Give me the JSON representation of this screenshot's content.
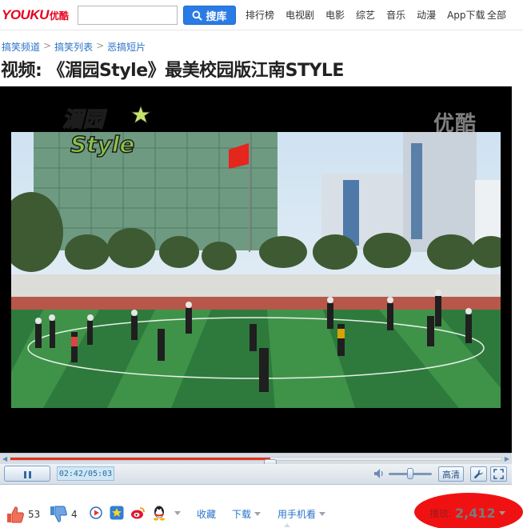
{
  "header": {
    "logo_text": "YOUKU",
    "logo_cn": "优酷",
    "search_placeholder": "",
    "search_button": "搜库",
    "nav": [
      "排行榜",
      "电视剧",
      "电影",
      "综艺",
      "音乐",
      "动漫",
      "App下载",
      "全部"
    ]
  },
  "breadcrumb": [
    "搞笑频道",
    "搞笑列表",
    "恶搞短片"
  ],
  "video": {
    "title": "视频: 《湄园Style》最美校园版江南STYLE",
    "watermark": "优酷",
    "show_logo_cn": "湄园",
    "show_logo_en": "Style",
    "progress_fraction": 0.53,
    "volume_fraction": 0.5
  },
  "controls": {
    "time": "02:42/05:03",
    "hd_label": "高清"
  },
  "actions": {
    "up_count": "53",
    "down_count": "4",
    "collect": "收藏",
    "download": "下载",
    "mobile": "用手机看",
    "plays_label": "播放:",
    "plays_count": "2,412"
  },
  "colors": {
    "brand_red": "#e8001f",
    "link_blue": "#2a73c9",
    "search_blue": "#2a7be4",
    "progress_red": "#e2341d",
    "highlight_red": "#f01212"
  },
  "icons": [
    "search-icon",
    "pause-icon",
    "volume-icon",
    "wrench-icon",
    "fullscreen-icon",
    "thumbs-up-icon",
    "thumbs-down-icon",
    "play-circle-icon",
    "star-icon",
    "weibo-icon",
    "qq-icon"
  ]
}
